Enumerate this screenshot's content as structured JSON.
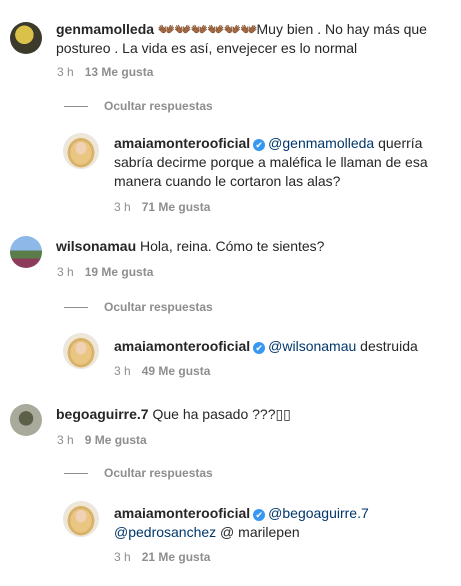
{
  "comments": [
    {
      "username": "genmamolleda",
      "emoji": "👐🏾👐🏾👐🏾👐🏾👐🏾👐🏾",
      "text": "Muy bien . No hay más que postureo . La vida es así, envejecer es lo normal",
      "time": "3 h",
      "likes": "13 Me gusta",
      "hide_replies": "Ocultar respuestas",
      "reply": {
        "username": "amaiamonterooficial",
        "mention": "@genmamolleda",
        "text": " querría sabría decirme porque a maléfica le llaman de esa manera cuando le cortaron las alas?",
        "time": "3 h",
        "likes": "71 Me gusta"
      }
    },
    {
      "username": "wilsonamau",
      "text": "Hola, reina. Cómo te sientes?",
      "time": "3 h",
      "likes": "19 Me gusta",
      "hide_replies": "Ocultar respuestas",
      "reply": {
        "username": "amaiamonterooficial",
        "mention": "@wilsonamau",
        "text": " destruida",
        "time": "3 h",
        "likes": "49 Me gusta"
      }
    },
    {
      "username": "begoaguirre.7",
      "text": "Que ha pasado ???▯▯",
      "time": "3 h",
      "likes": "9 Me gusta",
      "hide_replies": "Ocultar respuestas",
      "reply": {
        "username": "amaiamonterooficial",
        "mention": "@begoaguirre.7",
        "mention2": "@pedrosanchez",
        "text": " @ marilepen",
        "time": "3 h",
        "likes": "21 Me gusta"
      }
    }
  ],
  "icons": {
    "verified": "verified-badge-icon",
    "check": "✔"
  },
  "colors": {
    "text": "#262626",
    "secondary": "#8e8e8e",
    "mention": "#00376b",
    "verified": "#3897f0"
  }
}
